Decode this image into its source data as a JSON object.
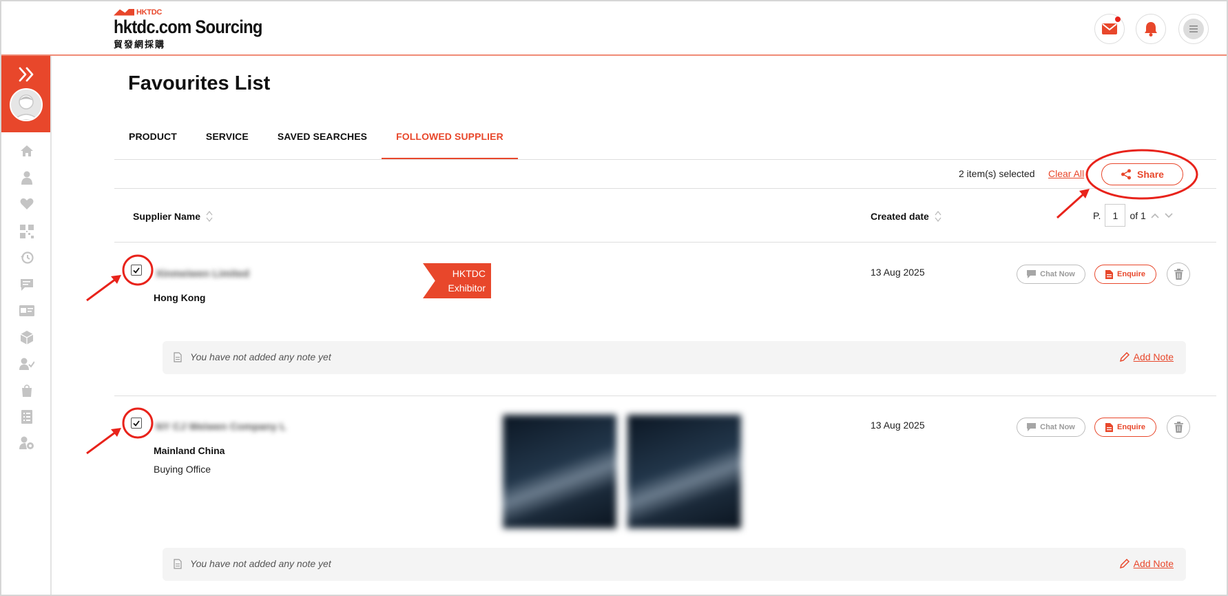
{
  "header": {
    "logo_mark": "HKTDC",
    "brand": "hktdc.com Sourcing",
    "brand_cn": "貿發網採購"
  },
  "page": {
    "title": "Favourites List"
  },
  "tabs": [
    {
      "label": "PRODUCT",
      "active": false
    },
    {
      "label": "SERVICE",
      "active": false
    },
    {
      "label": "SAVED SEARCHES",
      "active": false
    },
    {
      "label": "FOLLOWED SUPPLIER",
      "active": true
    }
  ],
  "selection": {
    "count_text": "2 item(s) selected",
    "clear_all": "Clear All",
    "share": "Share"
  },
  "table": {
    "col_supplier": "Supplier Name",
    "col_created": "Created date",
    "pager_prefix": "P.",
    "page_value": "1",
    "pager_suffix": "of 1"
  },
  "rows": [
    {
      "checked": true,
      "name": "Xinmeiwen Limited",
      "region": "Hong Kong",
      "exhibitor_line1": "HKTDC",
      "exhibitor_line2": "Exhibitor",
      "created": "13 Aug 2025",
      "chat": "Chat Now",
      "enquire": "Enquire",
      "note": "You have not added any note yet",
      "add_note": "Add Note"
    },
    {
      "checked": true,
      "name": "NY CJ Weiwen Company L",
      "region": "Mainland China",
      "type": "Buying Office",
      "created": "13 Aug 2025",
      "chat": "Chat Now",
      "enquire": "Enquire",
      "note": "You have not added any note yet",
      "add_note": "Add Note"
    }
  ],
  "colors": {
    "accent": "#e8472b",
    "annotation": "#e8231b"
  }
}
